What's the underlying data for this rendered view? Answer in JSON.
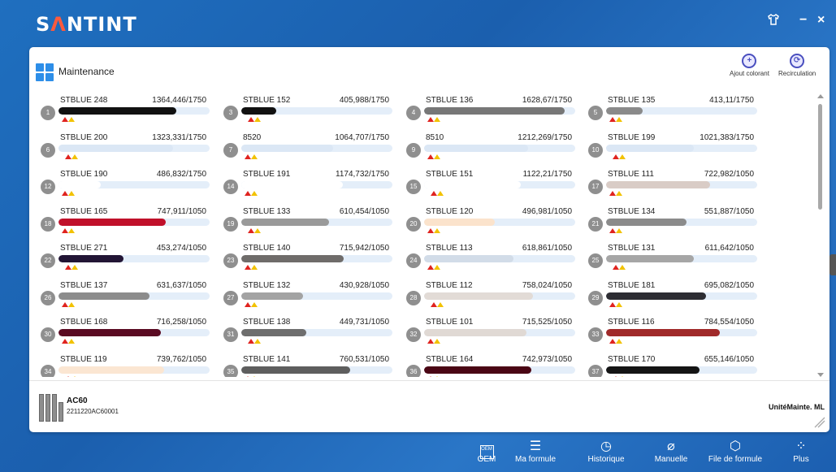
{
  "app": {
    "logo_prefix": "S",
    "logo_mid": "Λ",
    "logo_rest": "NTINT"
  },
  "window": {
    "skin_icon": "tshirt-icon",
    "minimize": "−",
    "close": "×"
  },
  "panel": {
    "title": "Maintenance",
    "actions": [
      {
        "label": "Ajout colorant",
        "icon": "add-colorant-icon"
      },
      {
        "label": "Recirculation",
        "icon": "recirculation-icon"
      }
    ]
  },
  "colorants": [
    {
      "num": "1",
      "name": "STBLUE 248",
      "value": "1364,446/1750",
      "level": 0.78,
      "color": "#111111"
    },
    {
      "num": "3",
      "name": "STBLUE 152",
      "value": "405,988/1750",
      "level": 0.23,
      "color": "#111111"
    },
    {
      "num": "4",
      "name": "STBLUE 136",
      "value": "1628,67/1750",
      "level": 0.93,
      "color": "#777777"
    },
    {
      "num": "5",
      "name": "STBLUE 135",
      "value": "413,11/1750",
      "level": 0.24,
      "color": "#8a8a8a"
    },
    {
      "num": "6",
      "name": "STBLUE 200",
      "value": "1323,331/1750",
      "level": 0.76,
      "color": "#dbe7f5"
    },
    {
      "num": "7",
      "name": "8520",
      "value": "1064,707/1750",
      "level": 0.61,
      "color": "#dbe7f5"
    },
    {
      "num": "9",
      "name": "8510",
      "value": "1212,269/1750",
      "level": 0.69,
      "color": "#dbe7f5"
    },
    {
      "num": "10",
      "name": "STBLUE 199",
      "value": "1021,383/1750",
      "level": 0.58,
      "color": "#dbe7f5"
    },
    {
      "num": "12",
      "name": "STBLUE 190",
      "value": "486,832/1750",
      "level": 0.28,
      "color": "#ffffff"
    },
    {
      "num": "14",
      "name": "STBLUE 191",
      "value": "1174,732/1750",
      "level": 0.67,
      "color": "#ffffff"
    },
    {
      "num": "15",
      "name": "STBLUE 151",
      "value": "1122,21/1750",
      "level": 0.64,
      "color": "#ffffff"
    },
    {
      "num": "17",
      "name": "STBLUE 111",
      "value": "722,982/1050",
      "level": 0.69,
      "color": "#d9ccc6"
    },
    {
      "num": "18",
      "name": "STBLUE 165",
      "value": "747,911/1050",
      "level": 0.71,
      "color": "#c0102a"
    },
    {
      "num": "19",
      "name": "STBLUE 133",
      "value": "610,454/1050",
      "level": 0.58,
      "color": "#9a9a9a"
    },
    {
      "num": "20",
      "name": "STBLUE 120",
      "value": "496,981/1050",
      "level": 0.47,
      "color": "#fbe3cc"
    },
    {
      "num": "21",
      "name": "STBLUE 134",
      "value": "551,887/1050",
      "level": 0.53,
      "color": "#8b8b8b"
    },
    {
      "num": "22",
      "name": "STBLUE 271",
      "value": "453,274/1050",
      "level": 0.43,
      "color": "#221535"
    },
    {
      "num": "23",
      "name": "STBLUE 140",
      "value": "715,942/1050",
      "level": 0.68,
      "color": "#6f6c6a"
    },
    {
      "num": "24",
      "name": "STBLUE 113",
      "value": "618,861/1050",
      "level": 0.59,
      "color": "#d2dce8"
    },
    {
      "num": "25",
      "name": "STBLUE 131",
      "value": "611,642/1050",
      "level": 0.58,
      "color": "#a6a6a6"
    },
    {
      "num": "26",
      "name": "STBLUE 137",
      "value": "631,637/1050",
      "level": 0.6,
      "color": "#8c8c8c"
    },
    {
      "num": "27",
      "name": "STBLUE 132",
      "value": "430,928/1050",
      "level": 0.41,
      "color": "#a3a3a3"
    },
    {
      "num": "28",
      "name": "STBLUE 112",
      "value": "758,024/1050",
      "level": 0.72,
      "color": "#e2dbd6"
    },
    {
      "num": "29",
      "name": "STBLUE 181",
      "value": "695,082/1050",
      "level": 0.66,
      "color": "#2d2d33"
    },
    {
      "num": "30",
      "name": "STBLUE 168",
      "value": "716,258/1050",
      "level": 0.68,
      "color": "#5a0a22"
    },
    {
      "num": "31",
      "name": "STBLUE 138",
      "value": "449,731/1050",
      "level": 0.43,
      "color": "#6e6e6e"
    },
    {
      "num": "32",
      "name": "STBLUE 101",
      "value": "715,525/1050",
      "level": 0.68,
      "color": "#e0d9d4"
    },
    {
      "num": "33",
      "name": "STBLUE 116",
      "value": "784,554/1050",
      "level": 0.75,
      "color": "#a02a2a"
    },
    {
      "num": "34",
      "name": "STBLUE 119",
      "value": "739,762/1050",
      "level": 0.7,
      "color": "#fbe6d2"
    },
    {
      "num": "35",
      "name": "STBLUE 141",
      "value": "760,531/1050",
      "level": 0.72,
      "color": "#5e5e5e"
    },
    {
      "num": "36",
      "name": "STBLUE 164",
      "value": "742,973/1050",
      "level": 0.71,
      "color": "#4a0614"
    },
    {
      "num": "37",
      "name": "STBLUE 170",
      "value": "655,146/1050",
      "level": 0.62,
      "color": "#141414"
    }
  ],
  "machine": {
    "name": "AC60",
    "serial": "2211220AC60001",
    "unit": "UnitéMainte. ML"
  },
  "nav": [
    {
      "label": "OEM",
      "icon": "oem-icon"
    },
    {
      "label": "Ma formule",
      "icon": "formula-list-icon"
    },
    {
      "label": "Historique",
      "icon": "history-icon"
    },
    {
      "label": "Manuelle",
      "icon": "manual-icon"
    },
    {
      "label": "File de formule",
      "icon": "formula-queue-icon"
    },
    {
      "label": "Plus",
      "icon": "more-grid-icon"
    }
  ]
}
